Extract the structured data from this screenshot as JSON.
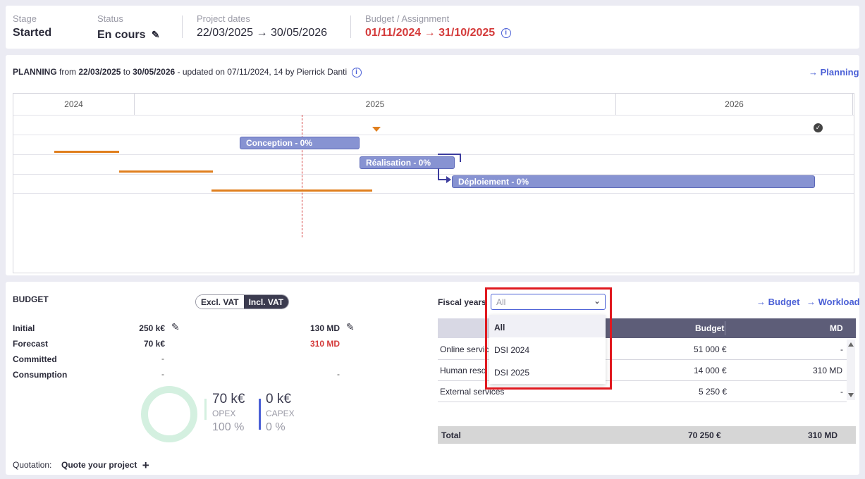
{
  "header": {
    "stage_label": "Stage",
    "stage_value": "Started",
    "status_label": "Status",
    "status_value": "En cours",
    "dates_label": "Project dates",
    "dates_value": "22/03/2025 → 30/05/2026",
    "budget_label": "Budget / Assignment",
    "budget_value": "01/11/2024 → 31/10/2025"
  },
  "planning": {
    "title": "PLANNING",
    "from_text": "from",
    "start": "22/03/2025",
    "to_text": "to",
    "end": "30/05/2026",
    "updated_text": "- updated on",
    "updated_date": "07/11/2024, 14",
    "by_text": "by",
    "author": "Pierrick Danti",
    "link": "Planning",
    "years": [
      "2024",
      "2025",
      "2026"
    ],
    "tasks": [
      {
        "label": "Conception - 0%"
      },
      {
        "label": "Réalisation - 0%"
      },
      {
        "label": "Déploiement - 0%"
      }
    ]
  },
  "budget": {
    "title": "BUDGET",
    "toggle_excl": "Excl. VAT",
    "toggle_incl": "Incl. VAT",
    "rows": [
      {
        "label": "Initial",
        "amount": "250 k€",
        "md": "130 MD"
      },
      {
        "label": "Forecast",
        "amount": "70 k€",
        "md": "310 MD"
      },
      {
        "label": "Committed",
        "amount": "-",
        "md": ""
      },
      {
        "label": "Consumption",
        "amount": "-",
        "md": "-"
      }
    ],
    "opex_value": "70 k€",
    "opex_label": "OPEX",
    "opex_pct": "100 %",
    "capex_value": "0 k€",
    "capex_label": "CAPEX",
    "capex_pct": "0 %",
    "quotation_label": "Quotation:",
    "quotation_action": "Quote your project"
  },
  "fiscal": {
    "label": "Fiscal years",
    "select_value": "All",
    "options": [
      "All",
      "DSI 2024",
      "DSI 2025"
    ],
    "budget_link": "Budget",
    "workload_link": "Workload",
    "col_budget": "Budget",
    "col_md": "MD",
    "rows": [
      {
        "name": "Online servic",
        "budget": "51 000 €",
        "md": "-"
      },
      {
        "name": "Human reso",
        "budget": "14 000 €",
        "md": "310 MD"
      },
      {
        "name": "External services",
        "budget": "5 250 €",
        "md": "-"
      }
    ],
    "total_label": "Total",
    "total_budget": "70 250 €",
    "total_md": "310 MD"
  },
  "colors": {
    "accent": "#4a5fd6",
    "danger": "#d43a3a",
    "bar": "#8793d2",
    "milestone": "#e07f1e",
    "highlight": "#e0191f"
  }
}
